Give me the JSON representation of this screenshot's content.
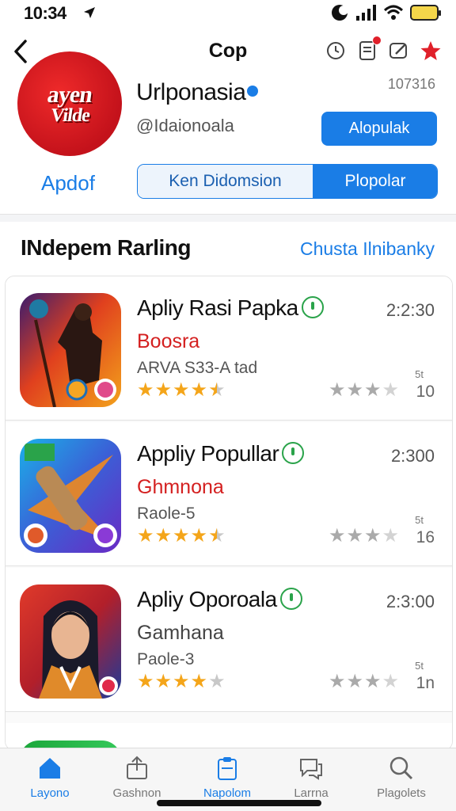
{
  "status_bar": {
    "time": "10:34"
  },
  "header": {
    "title": "Cop"
  },
  "profile": {
    "logo_line1": "ayen",
    "logo_line2": "Vilde",
    "name": "Urlponasia",
    "handle": "@Idaionoala",
    "count": "107316",
    "follow_label": "Alopulak",
    "link_label": "Apdof",
    "segments": [
      "Ken Didomsion",
      "Plopolar"
    ]
  },
  "section": {
    "title": "INdepem Rarling",
    "link": "Chusta Ilnibanky"
  },
  "apps": [
    {
      "name": "Apliy Rasi Papka",
      "time": "2:2:30",
      "category": "Boosra",
      "category_color": "#d42020",
      "sub": "ARVA S33-A tad",
      "rating_count": "10",
      "rating_mini": "5t",
      "stars_gold": 4.5,
      "stars_grey": 3
    },
    {
      "name": "Appliy Popullar",
      "time": "2:300",
      "category": "Ghmnona",
      "category_color": "#d42020",
      "sub": "Raole-5",
      "rating_count": "16",
      "rating_mini": "5t",
      "stars_gold": 4.5,
      "stars_grey": 3
    },
    {
      "name": "Apliy Oporoala",
      "time": "2:3:00",
      "category": "Gamhana",
      "category_color": "#444444",
      "sub": "Paole-3",
      "rating_count": "1n",
      "rating_mini": "5t",
      "stars_gold": 4,
      "stars_grey": 3
    }
  ],
  "tabs": [
    {
      "label": "Layono",
      "icon": "home-icon",
      "active": true
    },
    {
      "label": "Gashnon",
      "icon": "share-icon",
      "active": false
    },
    {
      "label": "Napolom",
      "icon": "clipboard-icon",
      "active": true
    },
    {
      "label": "Larrna",
      "icon": "chat-icon",
      "active": false
    },
    {
      "label": "Plagolets",
      "icon": "search-icon",
      "active": false
    }
  ],
  "colors": {
    "accent": "#1a7de6",
    "logo_red": "#d41c22",
    "star_gold": "#f4a51a",
    "verified_green": "#2aa34a"
  }
}
